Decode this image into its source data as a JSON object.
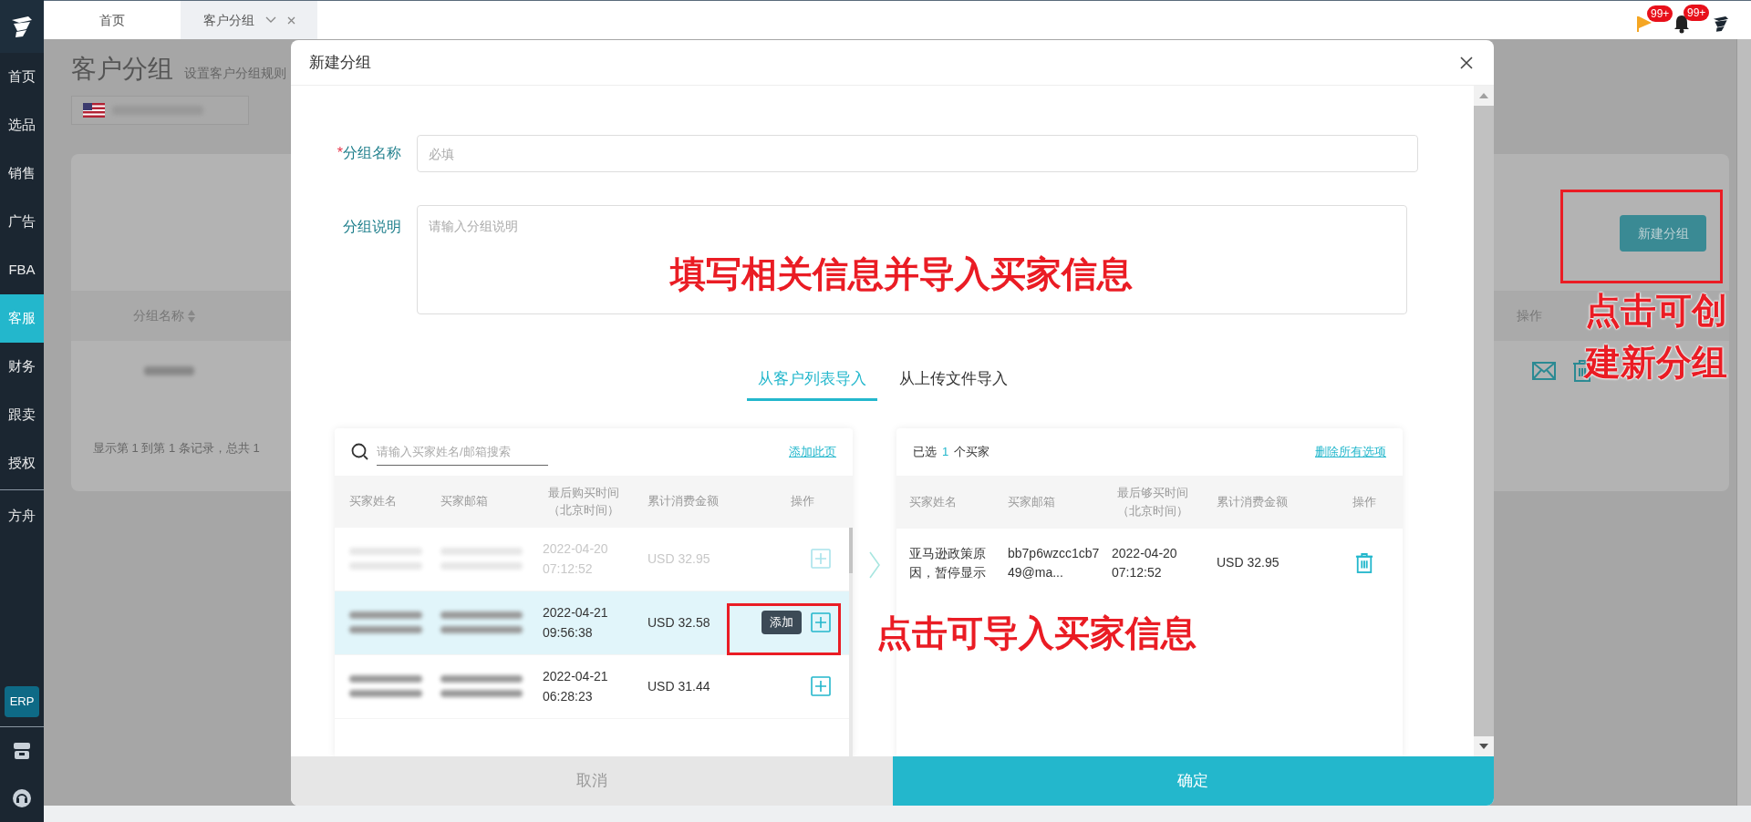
{
  "sidebar": {
    "items": [
      {
        "label": "首页",
        "selected": false
      },
      {
        "label": "选品",
        "selected": false
      },
      {
        "label": "销售",
        "selected": false
      },
      {
        "label": "广告",
        "selected": false
      },
      {
        "label": "FBA",
        "selected": false
      },
      {
        "label": "客服",
        "selected": true
      },
      {
        "label": "财务",
        "selected": false
      },
      {
        "label": "跟卖",
        "selected": false
      },
      {
        "label": "授权",
        "selected": false
      }
    ],
    "lower_items": [
      {
        "label": "方舟",
        "selected": false
      }
    ],
    "erp_button": "ERP"
  },
  "tabs": [
    {
      "label": "首页",
      "selected": false,
      "closable": false
    },
    {
      "label": "客户分组",
      "selected": true,
      "closable": true
    }
  ],
  "header_icons": [
    {
      "kind": "flag",
      "badge": "99+"
    },
    {
      "kind": "bell",
      "badge": "99+"
    },
    {
      "kind": "avatar"
    }
  ],
  "page": {
    "title": "客户分组",
    "subtitle": "设置客户分组规则",
    "new_group_button": "新建分组",
    "columns": [
      "分组名称",
      "操作"
    ],
    "summary": "显示第 1 到第 1 条记录，总共 1"
  },
  "dialog": {
    "title": "新建分组",
    "fields": [
      {
        "kind": "input",
        "required_mark": "*",
        "label": "分组名称",
        "placeholder": "必填"
      },
      {
        "kind": "textarea",
        "label": "分组说明",
        "placeholder": "请输入分组说明"
      }
    ],
    "import_tabs": [
      {
        "label": "从客户列表导入",
        "selected": true
      },
      {
        "label": "从上传文件导入",
        "selected": false
      }
    ],
    "source": {
      "search_placeholder": "请输入买家姓名/邮箱搜索",
      "add_page_link": "添加此页",
      "columns": [
        "买家姓名",
        "买家邮箱",
        "最后购买时间（北京时间）",
        "累计消费金额",
        "操作"
      ],
      "rows": [
        {
          "purchase_time": "2022-04-20 07:12:52",
          "amount": "USD 32.95",
          "added": true,
          "hovered": false
        },
        {
          "purchase_time": "2022-04-21 09:56:38",
          "amount": "USD 32.58",
          "added": false,
          "hovered": true,
          "tooltip": "添加"
        },
        {
          "purchase_time": "2022-04-21 06:28:23",
          "amount": "USD 31.44",
          "added": false,
          "hovered": false
        }
      ]
    },
    "chosen": {
      "count_prefix": "已选",
      "count": "1",
      "count_suffix": "个买家",
      "clear_link": "删除所有选项",
      "columns": [
        "买家姓名",
        "买家邮箱",
        "最后够买时间（北京时间）",
        "累计消费金额",
        "操作"
      ],
      "rows": [
        {
          "name": "亚马逊政策原因，暂停显示",
          "email": "bb7p6wzcc1cb749@ma...",
          "purchase_time": "2022-04-20 07:12:52",
          "amount": "USD 32.95"
        }
      ]
    },
    "cancel_button": "取消",
    "confirm_button": "确定"
  },
  "annotations": [
    {
      "kind": "box_with_text",
      "lines": [
        "点击可创",
        "建新分组"
      ]
    },
    {
      "kind": "text",
      "lines": [
        "填写相关信息并导入买家信息"
      ]
    },
    {
      "kind": "box_with_text",
      "lines": [
        "点击可导入买家信息"
      ]
    }
  ]
}
